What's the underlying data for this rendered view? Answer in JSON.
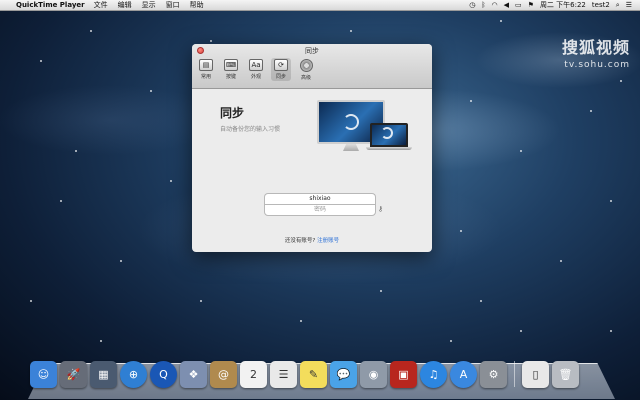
{
  "menubar": {
    "apple": "",
    "app_name": "QuickTime Player",
    "menus": [
      "文件",
      "编辑",
      "显示",
      "窗口",
      "帮助"
    ],
    "clock": "周二 下午6:22",
    "user": "test2"
  },
  "watermark": {
    "logo": "搜狐视频",
    "url": "tv.sohu.com"
  },
  "window": {
    "title": "同步",
    "toolbar": [
      {
        "label": "常用",
        "icon": "general-icon",
        "glyph": "▤"
      },
      {
        "label": "按键",
        "icon": "keyboard-icon",
        "glyph": "⌨"
      },
      {
        "label": "外观",
        "icon": "appearance-icon",
        "glyph": "Aa"
      },
      {
        "label": "同步",
        "icon": "sync-icon",
        "glyph": "⟳"
      },
      {
        "label": "高级",
        "icon": "advanced-gear-icon",
        "glyph": ""
      }
    ],
    "heading": "同步",
    "subtitle": "自动备份您的输入习惯",
    "username_value": "shixiao",
    "password_placeholder": "密码",
    "signup_prompt": "还没有账号?",
    "signup_link": "注册账号"
  },
  "dock": {
    "apps": [
      {
        "name": "finder-icon",
        "color": "#3b82d8",
        "glyph": "☺"
      },
      {
        "name": "launchpad-icon",
        "color": "#666c78",
        "glyph": "🚀"
      },
      {
        "name": "mission-control-icon",
        "color": "#4a5a70",
        "glyph": "▦"
      },
      {
        "name": "safari-icon",
        "color": "#2f7fd3",
        "glyph": "⊕"
      },
      {
        "name": "quicktime-icon",
        "color": "#1a57b5",
        "glyph": "Q"
      },
      {
        "name": "preview-icon",
        "color": "#7d8fb0",
        "glyph": "❖"
      },
      {
        "name": "contacts-icon",
        "color": "#b08a4e",
        "glyph": "@"
      },
      {
        "name": "calendar-icon",
        "color": "#f2f2f2",
        "glyph": "2"
      },
      {
        "name": "reminders-icon",
        "color": "#e9e9e9",
        "glyph": "☰"
      },
      {
        "name": "notes-icon",
        "color": "#f3dd5c",
        "glyph": "✎"
      },
      {
        "name": "messages-icon",
        "color": "#4aa3e8",
        "glyph": "💬"
      },
      {
        "name": "facetime-icon",
        "color": "#8f9aa8",
        "glyph": "◉"
      },
      {
        "name": "photo-booth-icon",
        "color": "#b8261e",
        "glyph": "▣"
      },
      {
        "name": "itunes-icon",
        "color": "#2c86e0",
        "glyph": "♫"
      },
      {
        "name": "app-store-icon",
        "color": "#3a88df",
        "glyph": "A"
      },
      {
        "name": "system-preferences-icon",
        "color": "#8a8f96",
        "glyph": "⚙"
      }
    ],
    "right_items": [
      {
        "name": "document-stack-icon",
        "color": "#e8e8e8",
        "glyph": "▯"
      },
      {
        "name": "trash-icon",
        "color": "#b8bcc2",
        "glyph": "🗑"
      }
    ]
  }
}
